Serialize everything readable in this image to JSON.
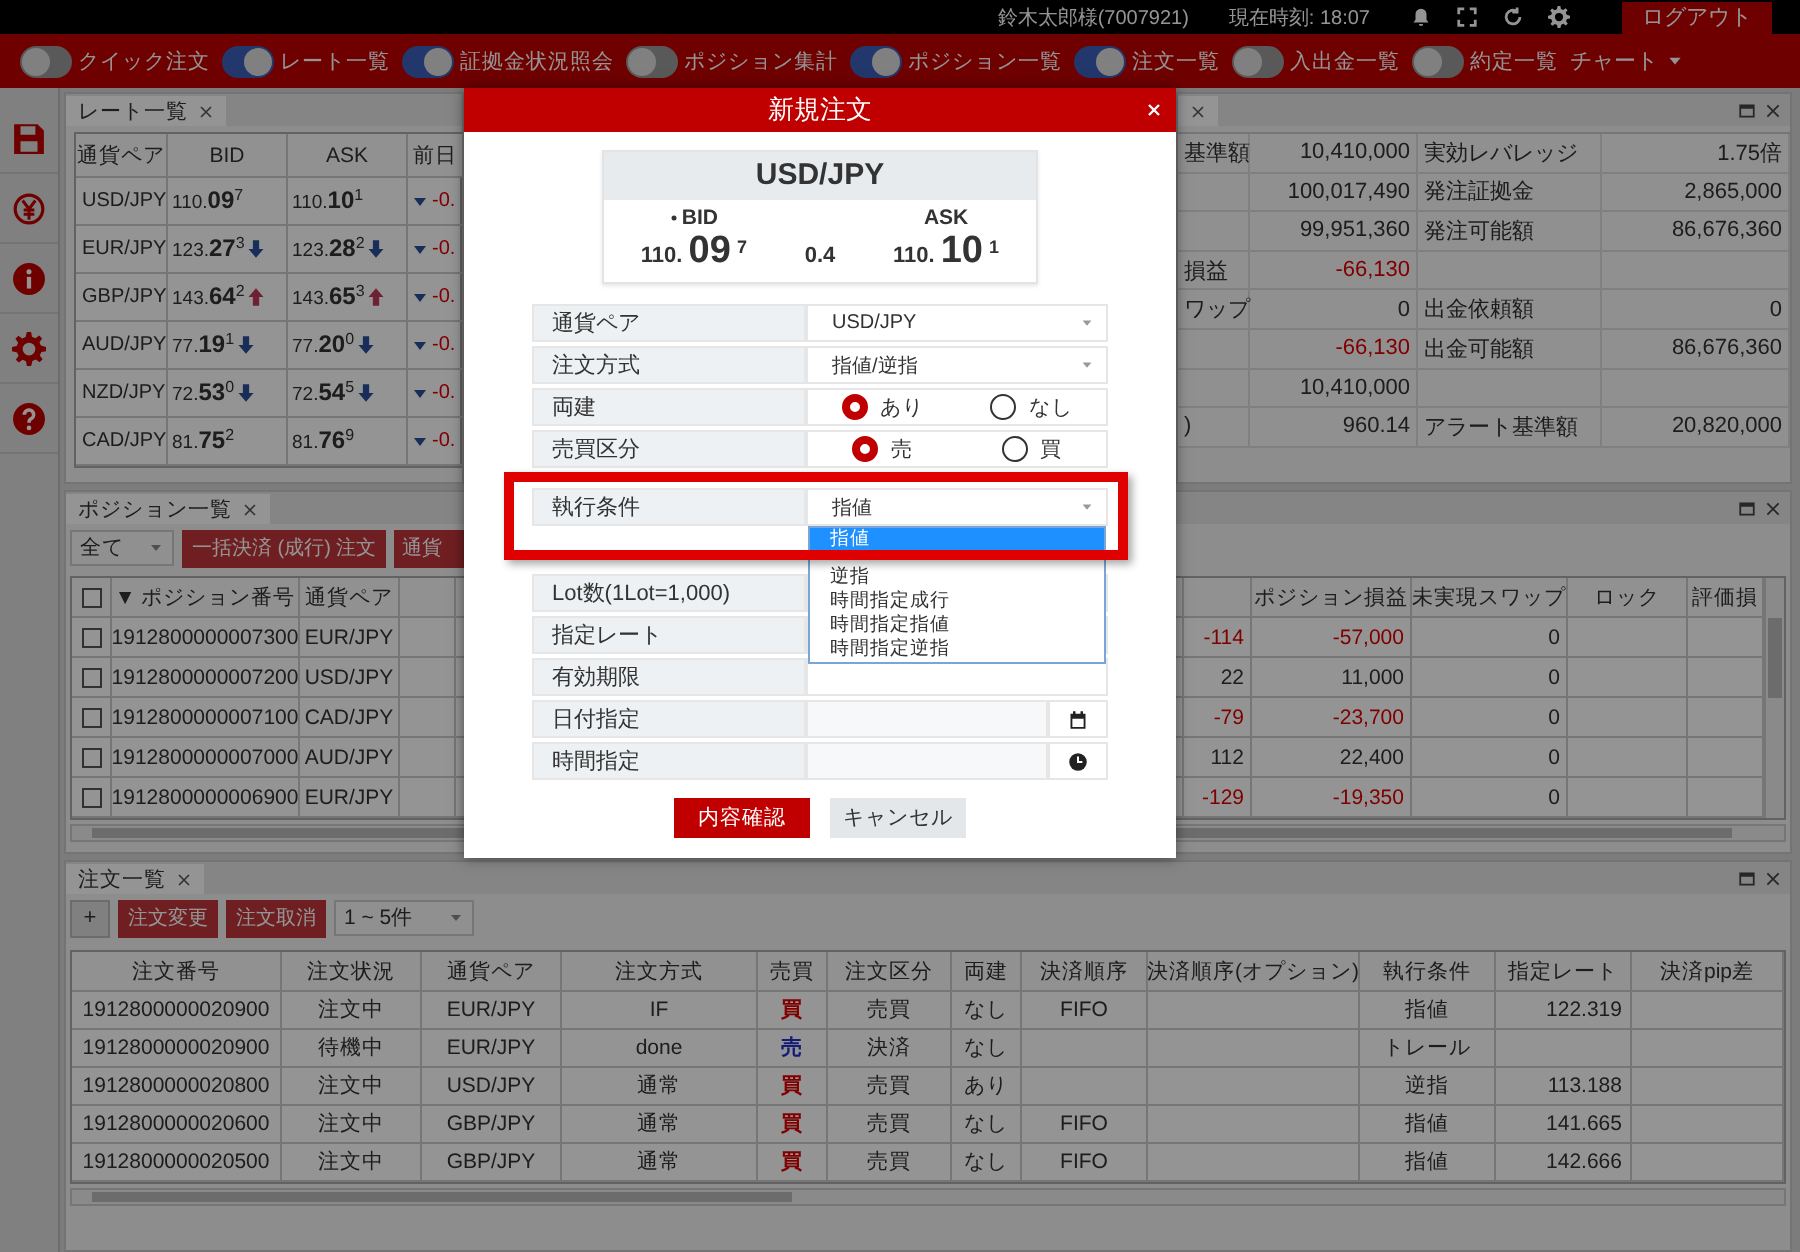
{
  "top_bar": {
    "user": "鈴木太郎様(7007921)",
    "clock": "現在時刻: 18:07",
    "logout": "ログアウト"
  },
  "toolbar": {
    "toggles": [
      {
        "label": "クイック注文",
        "on": false
      },
      {
        "label": "レート一覧",
        "on": true
      },
      {
        "label": "証拠金状況照会",
        "on": true
      },
      {
        "label": "ポジション集計",
        "on": false
      },
      {
        "label": "ポジション一覧",
        "on": true
      },
      {
        "label": "注文一覧",
        "on": true
      },
      {
        "label": "入出金一覧",
        "on": false
      },
      {
        "label": "約定一覧",
        "on": false
      }
    ],
    "menu": "チャート"
  },
  "rates_panel": {
    "tab": "レート一覧",
    "columns": [
      "通貨ペア",
      "BID",
      "ASK",
      "前日"
    ],
    "rows": [
      {
        "pair": "USD/JPY",
        "bid": {
          "text": "110.**09**$^{7}$",
          "kind": "plain"
        },
        "ask": {
          "text": "110.**10**$^{1}$",
          "kind": "plain"
        },
        "change": "-0."
      },
      {
        "pair": "EUR/JPY",
        "bid": {
          "text": "123.**27**$^{3}$",
          "kind": "down"
        },
        "ask": {
          "text": "123.**28**$^{2}$",
          "kind": "down"
        },
        "change": "-0."
      },
      {
        "pair": "GBP/JPY",
        "bid": {
          "text": "143.**64**$^{2}$",
          "kind": "up"
        },
        "ask": {
          "text": "143.**65**$^{3}$",
          "kind": "up"
        },
        "change": "-0."
      },
      {
        "pair": "AUD/JPY",
        "bid": {
          "text": "77.**19**$^{1}$",
          "kind": "down"
        },
        "ask": {
          "text": "77.**20**$^{0}$",
          "kind": "down"
        },
        "change": "-0."
      },
      {
        "pair": "NZD/JPY",
        "bid": {
          "text": "72.**53**$^{0}$",
          "kind": "down"
        },
        "ask": {
          "text": "72.**54**$^{5}$",
          "kind": "down"
        },
        "change": "-0."
      },
      {
        "pair": "CAD/JPY",
        "bid": {
          "text": "81.**75**$^{2}$",
          "kind": "plain"
        },
        "ask": {
          "text": "81.**76**$^{9}$",
          "kind": "plain"
        },
        "change": "-0."
      }
    ]
  },
  "account_panel": {
    "rows": [
      {
        "label": "基準額",
        "value": "10,410,000",
        "loss": false,
        "label_2": "実効レバレッジ",
        "value_2": "1.75倍"
      },
      {
        "value": "100,017,490",
        "loss": false,
        "label_2": "発注証拠金",
        "value_2": "2,865,000"
      },
      {
        "value": "99,951,360",
        "loss": false,
        "label_2": "発注可能額",
        "value_2": "86,676,360"
      },
      {
        "label": "損益",
        "value": "-66,130",
        "loss": true
      },
      {
        "label": "ワップ",
        "value": "0",
        "loss": false,
        "label_2": "出金依頼額",
        "value_2": "0"
      },
      {
        "value": "-66,130",
        "loss": true,
        "label_2": "出金可能額",
        "value_2": "86,676,360"
      },
      {
        "value": "10,410,000",
        "loss": false
      },
      {
        "label": ")",
        "value": "960.14",
        "loss": false,
        "label_2": "アラート基準額",
        "value_2": "20,820,000"
      }
    ]
  },
  "positions_panel": {
    "tab": "ポジション一覧",
    "filter": "全て",
    "buttons": [
      "一括決済 (成行) 注文",
      "通貨"
    ],
    "all_checked": false,
    "columns": {
      "number": "▼ ポジション番号",
      "pair": "通貨ペア",
      "pl": "ポジション損益",
      "swap": "未実現スワップ",
      "lock": "ロック",
      "column_10": "評価損"
    },
    "rows": [
      {
        "checked": false,
        "number": "1912800000007300",
        "pair": "EUR/JPY",
        "column_5": "-114",
        "pl": "-57,000",
        "swap": "0",
        "loss": true
      },
      {
        "checked": false,
        "number": "1912800000007200",
        "pair": "USD/JPY",
        "column_5": "22",
        "pl": "11,000",
        "swap": "0",
        "loss": false
      },
      {
        "checked": false,
        "number": "1912800000007100",
        "pair": "CAD/JPY",
        "column_5": "-79",
        "pl": "-23,700",
        "swap": "0",
        "loss": true
      },
      {
        "checked": false,
        "number": "1912800000007000",
        "pair": "AUD/JPY",
        "column_5": "112",
        "pl": "22,400",
        "swap": "0",
        "loss": false
      },
      {
        "checked": false,
        "number": "1912800000006900",
        "pair": "EUR/JPY",
        "column_5": "-129",
        "pl": "-19,350",
        "swap": "0",
        "loss": true
      }
    ]
  },
  "orders_panel": {
    "tab": "注文一覧",
    "add": "+",
    "buttons": [
      "注文変更",
      "注文取消"
    ],
    "range": "1 ~ 5件",
    "columns": [
      "注文番号",
      "注文状況",
      "通貨ペア",
      "注文方式",
      "売買",
      "注文区分",
      "両建",
      "決済順序",
      "決済順序(オプション)",
      "執行条件",
      "指定レート",
      "決済pip差"
    ],
    "rows": [
      {
        "kind": "buy",
        "cells": [
          "1912800000020900",
          "注文中",
          "EUR/JPY",
          "IF",
          "買",
          "売買",
          "なし",
          "FIFO",
          null,
          "指値",
          "122.319",
          null
        ]
      },
      {
        "kind": "sell",
        "cells": [
          "1912800000020900",
          "待機中",
          "EUR/JPY",
          "done",
          "売",
          "決済",
          "なし",
          null,
          null,
          "トレール",
          null,
          null
        ]
      },
      {
        "kind": "buy",
        "cells": [
          "1912800000020800",
          "注文中",
          "USD/JPY",
          "通常",
          "買",
          "売買",
          "あり",
          null,
          null,
          "逆指",
          "113.188",
          null
        ]
      },
      {
        "kind": "buy",
        "cells": [
          "1912800000020600",
          "注文中",
          "GBP/JPY",
          "通常",
          "買",
          "売買",
          "なし",
          "FIFO",
          null,
          "指値",
          "141.665",
          null
        ]
      },
      {
        "kind": "buy",
        "cells": [
          "1912800000020500",
          "注文中",
          "GBP/JPY",
          "通常",
          "買",
          "売買",
          "なし",
          "FIFO",
          null,
          "指値",
          "142.666",
          null
        ]
      }
    ]
  },
  "order_dialog": {
    "title": "新規注文",
    "quote": {
      "pair": "USD/JPY",
      "bid_label": "BID",
      "ask_label": "ASK",
      "bid": "110. **09** $^{7}$",
      "spread": "0.4",
      "ask": "110. **10** $^{1}$"
    },
    "fields": [
      {
        "kind": "select",
        "label": "通貨ペア",
        "value": "USD/JPY"
      },
      {
        "kind": "select",
        "label": "注文方式",
        "value": "指値/逆指"
      },
      {
        "kind": "radio",
        "label": "両建",
        "options": [
          {
            "label": "あり",
            "selected": true
          },
          {
            "label": "なし",
            "selected": false
          }
        ]
      },
      {
        "kind": "radio",
        "label": "売買区分",
        "options": [
          {
            "label": "売",
            "selected": true
          },
          {
            "label": "買",
            "selected": false
          }
        ]
      },
      {
        "kind": "select",
        "label": "執行条件",
        "value": "指値",
        "highlighted": true,
        "expanded": true,
        "options": [
          {
            "label": "指値",
            "selected": true
          },
          {
            "label": "逆指",
            "selected": false
          },
          {
            "label": "時間指定成行",
            "selected": false
          },
          {
            "label": "時間指定指値",
            "selected": false
          },
          {
            "label": "時間指定逆指",
            "selected": false
          }
        ]
      },
      {
        "kind": "text",
        "label": "Lot数(1Lot=1,000)"
      },
      {
        "kind": "text",
        "label": "指定レート"
      },
      {
        "kind": "text",
        "label": "有効期限"
      },
      {
        "kind": "date",
        "label": "日付指定"
      },
      {
        "kind": "time",
        "label": "時間指定"
      }
    ],
    "confirm": "内容確認",
    "cancel": "キャンセル"
  }
}
